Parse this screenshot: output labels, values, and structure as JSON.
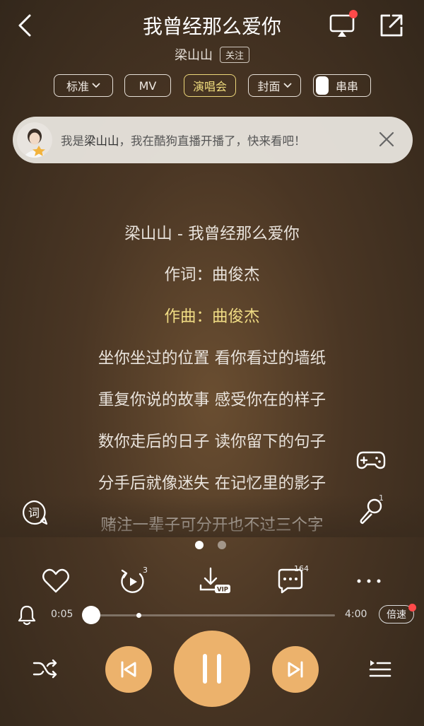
{
  "header": {
    "song_title": "我曾经那么爱你",
    "artist": "梁山山",
    "follow_label": "关注"
  },
  "chips": {
    "quality": "标准",
    "mv": "MV",
    "concert": "演唱会",
    "cover": "封面",
    "chuanchuan": "串串"
  },
  "banner": {
    "prefix": "我是",
    "name": "梁山山",
    "suffix": "，我在酷狗直播开播了，快来看吧！"
  },
  "lyrics": [
    {
      "text": "梁山山 - 我曾经那么爱你",
      "highlight": false
    },
    {
      "text": "作词：曲俊杰",
      "highlight": false
    },
    {
      "text": "作曲：曲俊杰",
      "highlight": true
    },
    {
      "text": "坐你坐过的位置 看你看过的墙纸",
      "highlight": false
    },
    {
      "text": "重复你说的故事 感受你在的样子",
      "highlight": false
    },
    {
      "text": "数你走后的日子 读你留下的句子",
      "highlight": false
    },
    {
      "text": "分手后就像迷失 在记忆里的影子",
      "highlight": false
    },
    {
      "text": "赌注一辈子可分开也不过三个字",
      "highlight": false
    }
  ],
  "side": {
    "mic_count": "1",
    "lyric_icon_char": "词"
  },
  "pager": {
    "count": 2,
    "active": 0
  },
  "actions": {
    "loop_count": "3",
    "comment_count": "164",
    "download_badge": "VIP"
  },
  "player": {
    "current_time": "0:05",
    "total_time": "4:00",
    "progress": 0.021,
    "buffered": 0.21,
    "speed_label": "倍速"
  },
  "colors": {
    "accent": "#ecb26c",
    "lyric_highlight": "#f0dc84",
    "notification_dot": "#ff4a4a"
  }
}
